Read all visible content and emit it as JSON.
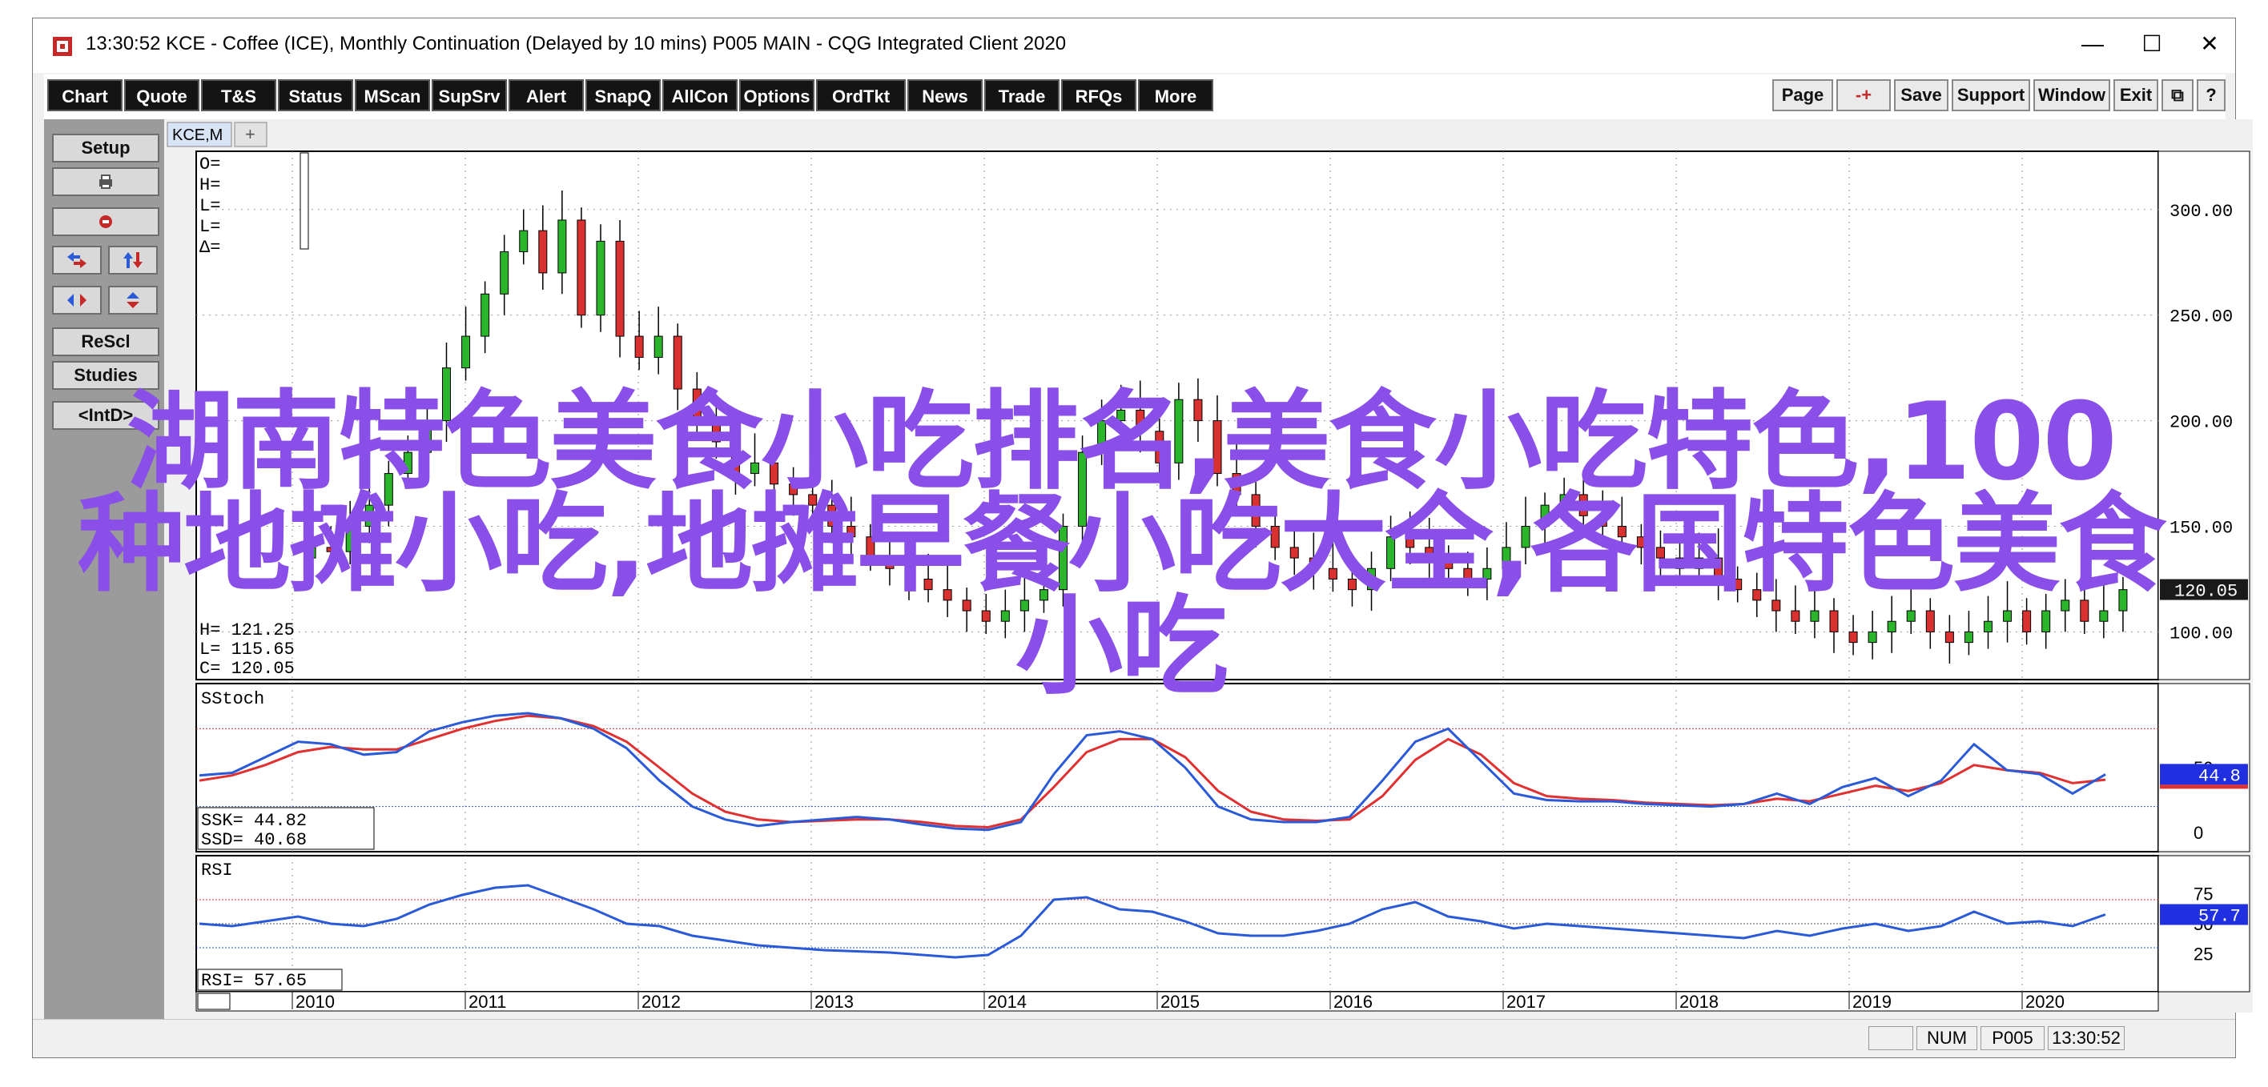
{
  "window": {
    "title": "13:30:52   KCE - Coffee (ICE), Monthly Continuation (Delayed by 10 mins)   P005 MAIN - CQG Integrated Client 2020",
    "minimize": "—",
    "maximize": "☐",
    "close": "✕"
  },
  "toolbar": {
    "buttons": [
      "Chart",
      "Quote",
      "T&S",
      "Status",
      "MScan",
      "SupSrv",
      "Alert",
      "SnapQ",
      "AllCon",
      "Options",
      "OrdTkt",
      "News",
      "Trade",
      "RFQs",
      "More"
    ],
    "right_buttons": [
      "Page",
      "-+",
      "Save",
      "Support",
      "Window",
      "Exit",
      "⧉",
      "?"
    ]
  },
  "sidebar": {
    "setup": "Setup",
    "rescl": "ReScl",
    "studies": "Studies",
    "intd": "<IntD>"
  },
  "chart_tab": {
    "label": "KCE,M",
    "add": "+"
  },
  "price_panel": {
    "ohlc_top": [
      "O=",
      "H=",
      "L=",
      "L=",
      "Δ="
    ],
    "ohlc_bottom": [
      "H=   121.25",
      "L=   115.65",
      "C=   120.05"
    ],
    "current_price": "120.05",
    "y_ticks": [
      "300.00",
      "250.00",
      "200.00",
      "150.00",
      "100.00"
    ]
  },
  "stoch_panel": {
    "name": "SStoch",
    "ssk_label": "SSK=     44.82",
    "ssd_label": "SSD=     40.68",
    "current": "44.8",
    "y_ticks": [
      "50",
      "0"
    ]
  },
  "rsi_panel": {
    "name": "RSI",
    "rsi_label": "RSI=    57.65",
    "current": "57.7",
    "y_ticks": [
      "75",
      "50",
      "25"
    ]
  },
  "x_axis": {
    "years": [
      "2010",
      "2011",
      "2012",
      "2013",
      "2014",
      "2015",
      "2016",
      "2017",
      "2018",
      "2019",
      "2020"
    ]
  },
  "status": {
    "num": "NUM",
    "account": "P005",
    "time": "13:30:52"
  },
  "overlay": {
    "line1": "湖南特色美食小吃排名,美食小吃特色,100",
    "line2": "种地摊小吃,地摊早餐小吃大全,各国特色美食",
    "line3": "小吃"
  },
  "colors": {
    "up_candle": "#2bb52b",
    "down_candle": "#d93030",
    "ssk_line": "#2a5ad8",
    "ssd_line": "#e03030",
    "rsi_line": "#2a5ad8",
    "overlay_text": "#8a4fe8",
    "current_price_box": "#1a1a1a",
    "indicator_box": "#2030e0"
  },
  "chart_data": {
    "type": "candlestick",
    "y_range_price": [
      85,
      320
    ],
    "x_years": [
      "2010",
      "2011",
      "2012",
      "2013",
      "2014",
      "2015",
      "2016",
      "2017",
      "2018",
      "2019",
      "2020"
    ],
    "monthly_close": [
      135,
      140,
      138,
      150,
      160,
      175,
      185,
      200,
      225,
      240,
      260,
      280,
      290,
      270,
      295,
      250,
      285,
      240,
      230,
      240,
      215,
      200,
      190,
      175,
      180,
      170,
      165,
      160,
      150,
      145,
      135,
      130,
      125,
      120,
      115,
      110,
      105,
      110,
      115,
      120,
      150,
      185,
      200,
      205,
      195,
      180,
      210,
      200,
      175,
      165,
      150,
      140,
      135,
      130,
      125,
      120,
      130,
      145,
      140,
      135,
      130,
      125,
      130,
      140,
      150,
      160,
      165,
      155,
      150,
      145,
      140,
      135,
      130,
      135,
      125,
      120,
      115,
      110,
      105,
      110,
      100,
      95,
      100,
      105,
      110,
      100,
      95,
      100,
      105,
      110,
      100,
      110,
      115,
      105,
      110,
      120
    ],
    "stoch_ssk": [
      44,
      46,
      58,
      70,
      68,
      60,
      62,
      78,
      85,
      90,
      92,
      88,
      80,
      65,
      40,
      20,
      10,
      5,
      8,
      10,
      12,
      10,
      6,
      3,
      2,
      8,
      45,
      75,
      78,
      72,
      50,
      20,
      10,
      8,
      8,
      12,
      40,
      70,
      80,
      55,
      30,
      25,
      24,
      24,
      22,
      21,
      20,
      22,
      30,
      22,
      35,
      42,
      28,
      40,
      68,
      48,
      45,
      30,
      44.82
    ],
    "stoch_ssd": [
      40,
      44,
      52,
      62,
      66,
      64,
      64,
      72,
      80,
      86,
      90,
      88,
      82,
      70,
      50,
      30,
      16,
      10,
      8,
      9,
      10,
      10,
      8,
      5,
      4,
      10,
      35,
      62,
      72,
      72,
      58,
      32,
      16,
      10,
      9,
      10,
      28,
      56,
      72,
      60,
      38,
      28,
      26,
      25,
      23,
      22,
      21,
      22,
      26,
      24,
      30,
      36,
      32,
      38,
      52,
      48,
      46,
      38,
      40.68
    ],
    "rsi": [
      50,
      48,
      52,
      56,
      50,
      48,
      54,
      66,
      74,
      80,
      82,
      72,
      62,
      50,
      48,
      40,
      36,
      32,
      30,
      28,
      27,
      26,
      24,
      22,
      24,
      40,
      70,
      72,
      62,
      60,
      52,
      42,
      40,
      40,
      44,
      50,
      62,
      68,
      56,
      52,
      46,
      50,
      48,
      46,
      44,
      42,
      40,
      38,
      44,
      40,
      46,
      50,
      44,
      48,
      60,
      50,
      52,
      48,
      57.65
    ]
  }
}
